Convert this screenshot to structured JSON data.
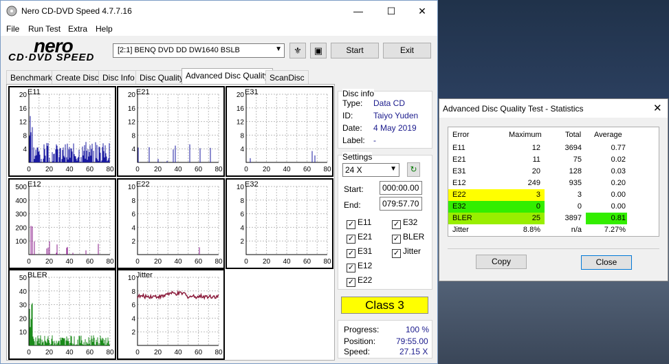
{
  "main": {
    "title": "Nero CD-DVD Speed 4.7.7.16",
    "menu": [
      "File",
      "Run Test",
      "Extra",
      "Help"
    ],
    "logo_top": "nero",
    "logo_bottom": "CD·DVD SPEED",
    "drive": "[2:1]   BENQ DVD DD DW1640 BSLB",
    "start": "Start",
    "exit": "Exit",
    "tabs": [
      "Benchmark",
      "Create Disc",
      "Disc Info",
      "Disc Quality",
      "Advanced Disc Quality",
      "ScanDisc"
    ],
    "discinfo": {
      "heading": "Disc info",
      "type_l": "Type:",
      "type": "Data CD",
      "id_l": "ID:",
      "id": "Taiyo Yuden",
      "date_l": "Date:",
      "date": "4 May 2019",
      "label_l": "Label:",
      "label": "-"
    },
    "settings": {
      "heading": "Settings",
      "speed": "24 X",
      "start_l": "Start:",
      "start": "000:00.00",
      "end_l": "End:",
      "end": "079:57.70",
      "checks": [
        "E11",
        "E32",
        "E21",
        "BLER",
        "E31",
        "Jitter",
        "E12",
        "E22"
      ]
    },
    "class": "Class 3",
    "progress": {
      "prog_l": "Progress:",
      "prog": "100 %",
      "pos_l": "Position:",
      "pos": "79:55.00",
      "speed_l": "Speed:",
      "speed": "27.15 X"
    }
  },
  "charts": [
    {
      "name": "E11",
      "yticks": [
        "20",
        "16",
        "12",
        "8",
        "4"
      ],
      "xticks": [
        "0",
        "20",
        "40",
        "60",
        "80"
      ],
      "color": "#1a1aa0"
    },
    {
      "name": "E21",
      "yticks": [
        "20",
        "16",
        "12",
        "8",
        "4"
      ],
      "xticks": [
        "0",
        "20",
        "40",
        "60",
        "80"
      ],
      "color": "#1a1aa0"
    },
    {
      "name": "E31",
      "yticks": [
        "20",
        "16",
        "12",
        "8",
        "4"
      ],
      "xticks": [
        "0",
        "20",
        "40",
        "60",
        "80"
      ],
      "color": "#1a1aa0"
    },
    {
      "name": "E12",
      "yticks": [
        "500",
        "400",
        "300",
        "200",
        "100"
      ],
      "xticks": [
        "0",
        "20",
        "40",
        "60",
        "80"
      ],
      "color": "#8a1a8a"
    },
    {
      "name": "E22",
      "yticks": [
        "10",
        "8",
        "6",
        "4",
        "2"
      ],
      "xticks": [
        "0",
        "20",
        "40",
        "60",
        "80"
      ],
      "color": "#8a1a8a"
    },
    {
      "name": "E32",
      "yticks": [
        "10",
        "8",
        "6",
        "4",
        "2"
      ],
      "xticks": [
        "0",
        "20",
        "40",
        "60",
        "80"
      ],
      "color": "#8a1a8a"
    },
    {
      "name": "BLER",
      "yticks": [
        "50",
        "40",
        "30",
        "20",
        "10"
      ],
      "xticks": [
        "0",
        "20",
        "40",
        "60",
        "80"
      ],
      "color": "#1a8a1a"
    },
    {
      "name": "Jitter",
      "yticks": [
        "10",
        "8",
        "6",
        "4",
        "2"
      ],
      "xticks": [
        "0",
        "20",
        "40",
        "60",
        "80"
      ],
      "color": "#8a1a3a"
    }
  ],
  "stats": {
    "title": "Advanced Disc Quality Test - Statistics",
    "headers": [
      "Error",
      "Maximum",
      "Total",
      "Average"
    ],
    "rows": [
      {
        "e": "E11",
        "m": "12",
        "t": "3694",
        "a": "0.77"
      },
      {
        "e": "E21",
        "m": "11",
        "t": "75",
        "a": "0.02"
      },
      {
        "e": "E31",
        "m": "20",
        "t": "128",
        "a": "0.03"
      },
      {
        "e": "E12",
        "m": "249",
        "t": "935",
        "a": "0.20"
      },
      {
        "e": "E22",
        "m": "3",
        "t": "3",
        "a": "0.00"
      },
      {
        "e": "E32",
        "m": "0",
        "t": "0",
        "a": "0.00"
      },
      {
        "e": "BLER",
        "m": "25",
        "t": "3897",
        "a": "0.81"
      },
      {
        "e": "Jitter",
        "m": "8.8%",
        "t": "n/a",
        "a": "7.27%"
      }
    ],
    "copy": "Copy",
    "close": "Close",
    "highlight_yellow": "#ffff00",
    "highlight_green": "#33ee00",
    "highlight_lime": "#99ee00"
  }
}
